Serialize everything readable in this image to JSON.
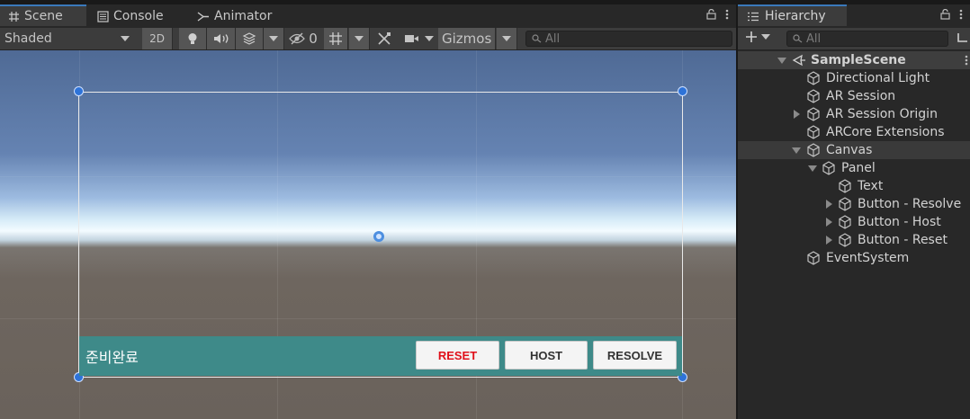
{
  "scene_tabs": [
    {
      "label": "Scene",
      "icon": "grid-icon"
    },
    {
      "label": "Console",
      "icon": "console-icon"
    },
    {
      "label": "Animator",
      "icon": "animator-icon"
    }
  ],
  "toolbar": {
    "draw_mode": "Shaded",
    "mode_2d": "2D",
    "hidden_count": "0",
    "gizmos": "Gizmos",
    "search_placeholder": "All"
  },
  "game_ui": {
    "status_text": "준비완료",
    "buttons": [
      {
        "label": "RESET",
        "color": "#e0101a"
      },
      {
        "label": "HOST",
        "color": "#323232"
      },
      {
        "label": "RESOLVE",
        "color": "#323232"
      }
    ]
  },
  "hierarchy": {
    "title": "Hierarchy",
    "search_placeholder": "All",
    "scene_name": "SampleScene",
    "items": [
      {
        "label": "Directional Light",
        "depth": 1,
        "expander": "none"
      },
      {
        "label": "AR Session",
        "depth": 1,
        "expander": "none"
      },
      {
        "label": "AR Session Origin",
        "depth": 1,
        "expander": "collapsed"
      },
      {
        "label": "ARCore Extensions",
        "depth": 1,
        "expander": "none"
      },
      {
        "label": "Canvas",
        "depth": 1,
        "expander": "expanded",
        "selected": true
      },
      {
        "label": "Panel",
        "depth": 2,
        "expander": "expanded"
      },
      {
        "label": "Text",
        "depth": 3,
        "expander": "none"
      },
      {
        "label": "Button - Resolve",
        "depth": 3,
        "expander": "collapsed"
      },
      {
        "label": "Button - Host",
        "depth": 3,
        "expander": "collapsed"
      },
      {
        "label": "Button - Reset",
        "depth": 3,
        "expander": "collapsed"
      },
      {
        "label": "EventSystem",
        "depth": 1,
        "expander": "none"
      }
    ]
  },
  "colors": {
    "accent": "#3a79bb",
    "panel_teal": "#3e8a89",
    "handle_blue": "#2e73d8"
  }
}
